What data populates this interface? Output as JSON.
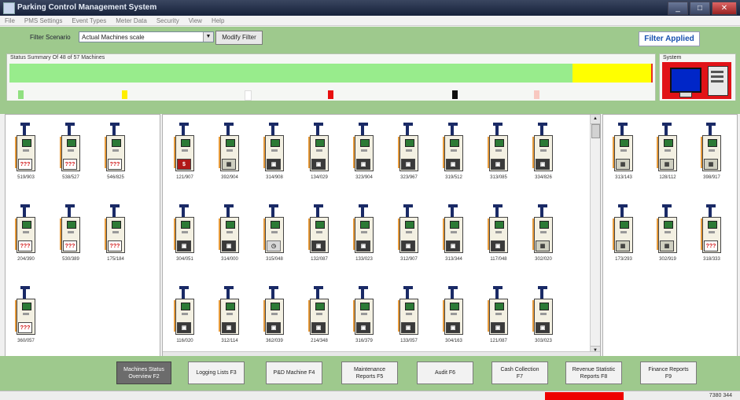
{
  "window": {
    "title": "Parking Control Management System",
    "buttons": {
      "minimize": "_",
      "maximize": "□",
      "close": "✕"
    }
  },
  "menu": [
    "File",
    "PMS Settings",
    "Event Types",
    "Meter Data",
    "Security",
    "View",
    "Help"
  ],
  "filter": {
    "label": "Filter Scenario",
    "selected": "Actual Machines scale",
    "modify_label": "Modify Filter",
    "applied_label": "Filter Applied"
  },
  "summary": {
    "title": "Status Summary Of 48 of 57 Machines",
    "system_title": "System",
    "colors": {
      "ok": "#98ec8c",
      "warning": "#ffff00",
      "alarm": "#e83020"
    }
  },
  "legend_chips": [
    {
      "color": "#90e080"
    },
    {
      "color": "#ffee00"
    },
    {
      "color": "#ffffff"
    },
    {
      "color": "#e81010"
    },
    {
      "color": "#101010"
    },
    {
      "color": "#f8c8c0"
    }
  ],
  "left_panel": {
    "machines": [
      {
        "label": "519/903",
        "status": "???",
        "kind": "q"
      },
      {
        "label": "538/527",
        "status": "???",
        "kind": "q"
      },
      {
        "label": "546/825",
        "status": "???",
        "kind": "q"
      },
      {
        "label": "204/390",
        "status": "???",
        "kind": "q"
      },
      {
        "label": "530/389",
        "status": "???",
        "kind": "q"
      },
      {
        "label": "175/184",
        "status": "???",
        "kind": "q"
      },
      {
        "label": "360/057",
        "status": "???",
        "kind": "q"
      }
    ]
  },
  "middle_panel": {
    "machines": [
      {
        "label": "121/907",
        "status": "$",
        "kind": "s"
      },
      {
        "label": "392/904",
        "status": "▦",
        "kind": "g"
      },
      {
        "label": "314/908",
        "status": "▣",
        "kind": "v"
      },
      {
        "label": "134/029",
        "status": "▣",
        "kind": "v"
      },
      {
        "label": "323/904",
        "status": "▣",
        "kind": "v"
      },
      {
        "label": "323/967",
        "status": "▣",
        "kind": "v"
      },
      {
        "label": "319/512",
        "status": "▣",
        "kind": "v"
      },
      {
        "label": "313/085",
        "status": "▣",
        "kind": "v"
      },
      {
        "label": "334/826",
        "status": "▣",
        "kind": "v"
      },
      {
        "label": "304/051",
        "status": "▣",
        "kind": "v"
      },
      {
        "label": "314/000",
        "status": "▣",
        "kind": "v"
      },
      {
        "label": "315/048",
        "status": "◷",
        "kind": "c"
      },
      {
        "label": "132/087",
        "status": "▣",
        "kind": "v"
      },
      {
        "label": "133/023",
        "status": "▣",
        "kind": "v"
      },
      {
        "label": "312/907",
        "status": "▣",
        "kind": "v"
      },
      {
        "label": "313/344",
        "status": "▣",
        "kind": "v"
      },
      {
        "label": "117/048",
        "status": "▣",
        "kind": "v"
      },
      {
        "label": "302/020",
        "status": "▦",
        "kind": "g"
      },
      {
        "label": "116/020",
        "status": "▣",
        "kind": "v"
      },
      {
        "label": "312/114",
        "status": "▣",
        "kind": "v"
      },
      {
        "label": "362/039",
        "status": "▣",
        "kind": "v"
      },
      {
        "label": "214/348",
        "status": "▣",
        "kind": "v"
      },
      {
        "label": "316/379",
        "status": "▣",
        "kind": "v"
      },
      {
        "label": "133/057",
        "status": "▣",
        "kind": "v"
      },
      {
        "label": "304/163",
        "status": "▣",
        "kind": "v"
      },
      {
        "label": "121/087",
        "status": "▣",
        "kind": "v"
      },
      {
        "label": "303/023",
        "status": "▣",
        "kind": "v"
      }
    ]
  },
  "right_panel": {
    "machines": [
      {
        "label": "313/143",
        "status": "▦",
        "kind": "g"
      },
      {
        "label": "128/112",
        "status": "▦",
        "kind": "g"
      },
      {
        "label": "398/917",
        "status": "▦",
        "kind": "g"
      },
      {
        "label": "173/293",
        "status": "▦",
        "kind": "g"
      },
      {
        "label": "302/919",
        "status": "▦",
        "kind": "g"
      },
      {
        "label": "318/333",
        "status": "???",
        "kind": "q"
      }
    ]
  },
  "nav": [
    {
      "label": "Machines Status\nOverview F2",
      "active": true
    },
    {
      "label": "Logging Lists F3",
      "active": false
    },
    {
      "label": "P&D Machine F4",
      "active": false
    },
    {
      "label": "Maintenance\nReports F5",
      "active": false
    },
    {
      "label": "Audit F6",
      "active": false
    },
    {
      "label": "Cash Collection\nF7",
      "active": false
    },
    {
      "label": "Revenue Statistic\nReports F8",
      "active": false
    },
    {
      "label": "Finance Reports\nF9",
      "active": false
    }
  ],
  "statusbar": {
    "text": "7380 344"
  }
}
